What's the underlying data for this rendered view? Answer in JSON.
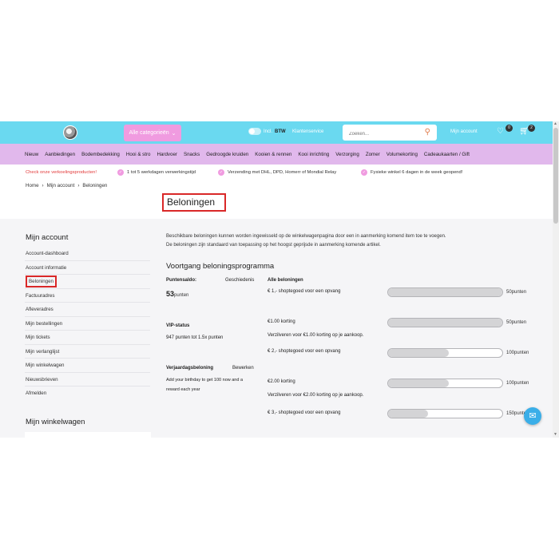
{
  "header": {
    "categories_button": "Alle categorieën",
    "vat_toggle_label": "Incl.",
    "vat_label": "BTW",
    "customer_service": "Klantenservice",
    "search_placeholder": "Zoeken...",
    "my_account": "Mijn account",
    "wishlist_count": "0",
    "cart_count": "2"
  },
  "nav": [
    "Nieuw",
    "Aanbiedingen",
    "Bodembedekking",
    "Hooi & stro",
    "Hardvoer",
    "Snacks",
    "Gedroogde kruiden",
    "Kooien & rennen",
    "Kooi inrichting",
    "Verzorging",
    "Zomer",
    "Volumekorting",
    "Cadeaukaarten / Gift"
  ],
  "usp": {
    "alert": "Check onze verkoelingsproducten!",
    "items": [
      "1 tot 5 werkdagen verwerkingstijd",
      "Verzending met DHL, DPD, Homerr of Mondial Relay",
      "Fysieke winkel 6 dagen in de week geopend!"
    ]
  },
  "breadcrumb": [
    "Home",
    "Mijn account",
    "Beloningen"
  ],
  "page_title": "Beloningen",
  "sidebar": {
    "title": "Mijn account",
    "items": [
      "Account-dashboard",
      "Account informatie",
      "Beloningen",
      "Factuuradres",
      "Afleveradres",
      "Mijn bestellingen",
      "Mijn tickets",
      "Mijn verlanglijst",
      "Mijn winkelwagen",
      "Nieuwsbrieven",
      "Afmelden"
    ],
    "active": "Beloningen",
    "cart_title": "Mijn winkelwagen"
  },
  "content": {
    "intro_1": "Beschikbare beloningen kunnen worden ingewisseld op de winkelwagenpagina door een in aanmerking komend item toe te voegen.",
    "intro_2": "De beloningen zijn standaard van toepassing op het hoogst geprijsde in aanmerking komende artikel.",
    "progress_title": "Voortgang beloningsprogramma",
    "points_balance_label": "Puntensaldo:",
    "history_label": "Geschiedenis",
    "all_rewards_label": "Alle beloningen",
    "points_value": "53",
    "points_unit": "punten",
    "vip_label": "VIP-status",
    "vip_text": "947 punten tot 1.5x punten",
    "birthday_label": "Verjaardagsbeloning",
    "edit_label": "Bewerken",
    "birthday_text_1": "Add your birthday to get 100 now and a",
    "birthday_text_2": "reward each year",
    "rewards": [
      {
        "name": "€ 1,- shoptegoed voor een opvang",
        "sub": "",
        "points": "50punten",
        "progress": 1.0
      },
      {
        "name": "€1.00 korting",
        "sub": "Verzilveren voor €1.00 korting op je aankoop.",
        "points": "50punten",
        "progress": 1.0
      },
      {
        "name": "€ 2,- shoptegoed voor een opvang",
        "sub": "",
        "points": "100punten",
        "progress": 0.53
      },
      {
        "name": "€2.00 korting",
        "sub": "Verzilveren voor €2.00 korting op je aankoop.",
        "points": "100punten",
        "progress": 0.53
      },
      {
        "name": "€ 3,- shoptegoed voor een opvang",
        "sub": "",
        "points": "150punten",
        "progress": 0.35
      }
    ]
  }
}
